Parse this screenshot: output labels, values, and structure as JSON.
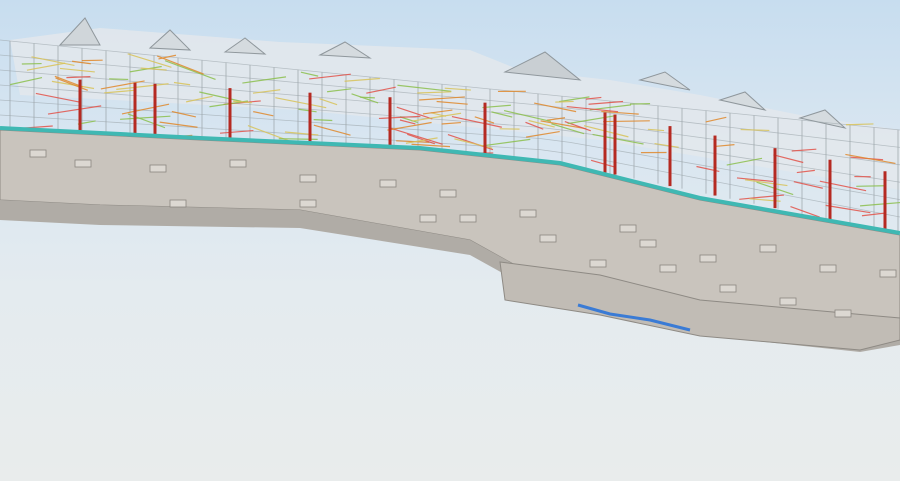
{
  "viewport": {
    "kind": "3D BIM model view",
    "sky_top_color": "#c7ddef",
    "sky_bottom_color": "#e9ecec"
  },
  "model": {
    "slab_color": "#c9c4bd",
    "slab_underside_color": "#bdb8b1",
    "slab_edge_color": "#3fb8b3",
    "column_color": "#b52a22",
    "pipe_colors": [
      "#e0892c",
      "#8cc04e",
      "#d8c35a",
      "#e2534a"
    ],
    "frame_color": "#9aa3a8",
    "duct_highlight_color": "#3a7bd5"
  }
}
